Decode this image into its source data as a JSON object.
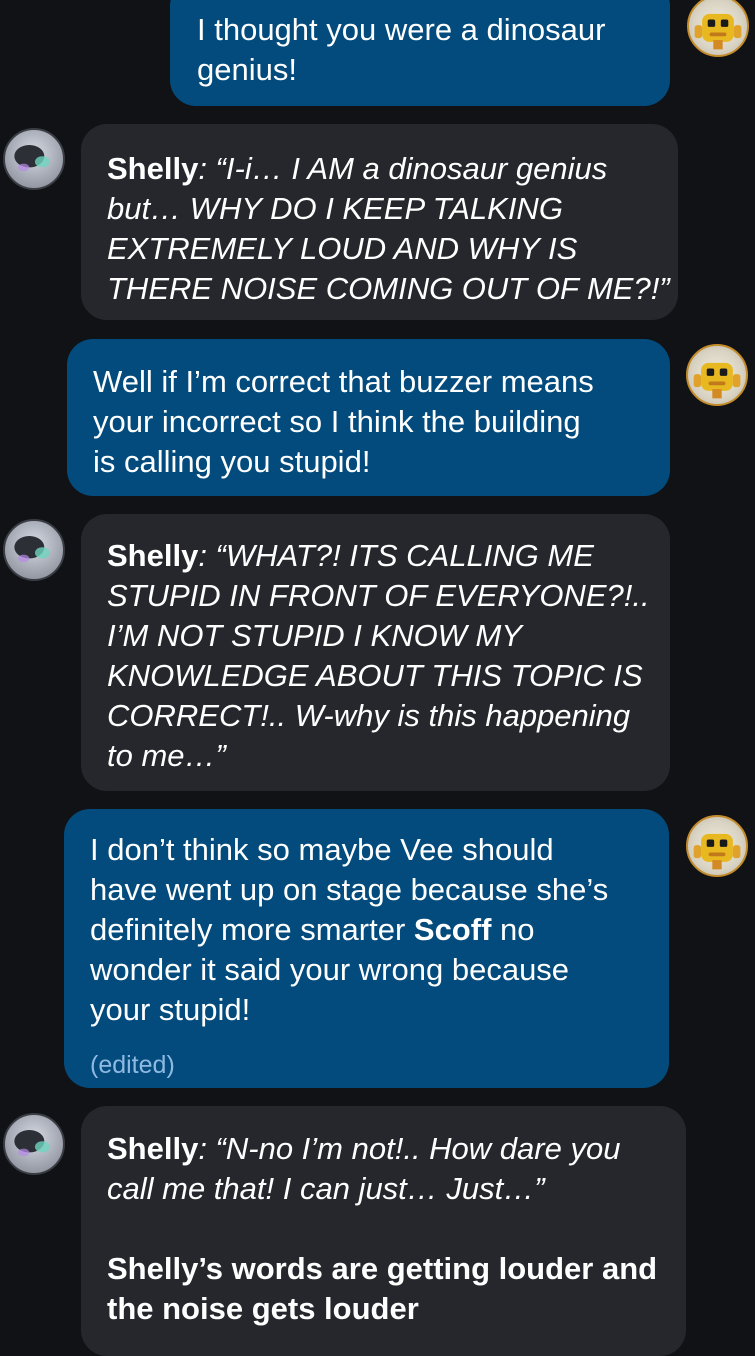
{
  "messages": [
    {
      "sender": "user",
      "lines": [
        "I thought you were a dinosaur",
        "genius!"
      ]
    },
    {
      "sender": "shelly",
      "speaker": "Shelly",
      "lines": [
        ": “I-i… I AM a dinosaur genius",
        "but… WHY DO I KEEP TALKING",
        "EXTREMELY LOUD AND WHY IS",
        "THERE NOISE COMING OUT OF ME?!”"
      ]
    },
    {
      "sender": "user",
      "lines": [
        "Well if I’m correct that buzzer means",
        "your incorrect so I think the building",
        "is calling you stupid!"
      ]
    },
    {
      "sender": "shelly",
      "speaker": "Shelly",
      "lines": [
        ": “WHAT?! ITS CALLING ME",
        "STUPID IN FRONT OF EVERYONE?!..",
        "I’M NOT STUPID I KNOW MY",
        "KNOWLEDGE ABOUT THIS TOPIC IS",
        "CORRECT!.. W-why is this happening",
        "to me…”"
      ]
    },
    {
      "sender": "user",
      "lines": [
        "I don’t think so maybe Vee should",
        "have went up on stage because she’s",
        "definitely more smarter ",
        " no",
        "wonder it said your wrong because",
        "your stupid!"
      ],
      "bold_word": "Scoff",
      "edited_label": "(edited)"
    },
    {
      "sender": "shelly",
      "speaker": "Shelly",
      "lines": [
        ": “N-no I’m not!.. How dare you",
        "call me that! I can just… Just…”"
      ],
      "narration": [
        "Shelly’s words are getting louder and",
        "the noise gets louder"
      ]
    }
  ],
  "avatars": {
    "user": "yellow-robot-avatar",
    "shelly": "shelly-avatar"
  },
  "colors": {
    "background": "#111215",
    "outgoing_bubble": "#024b7c",
    "incoming_bubble": "#25272c",
    "text": "#ffffff",
    "edited": "#8fb9e3"
  }
}
